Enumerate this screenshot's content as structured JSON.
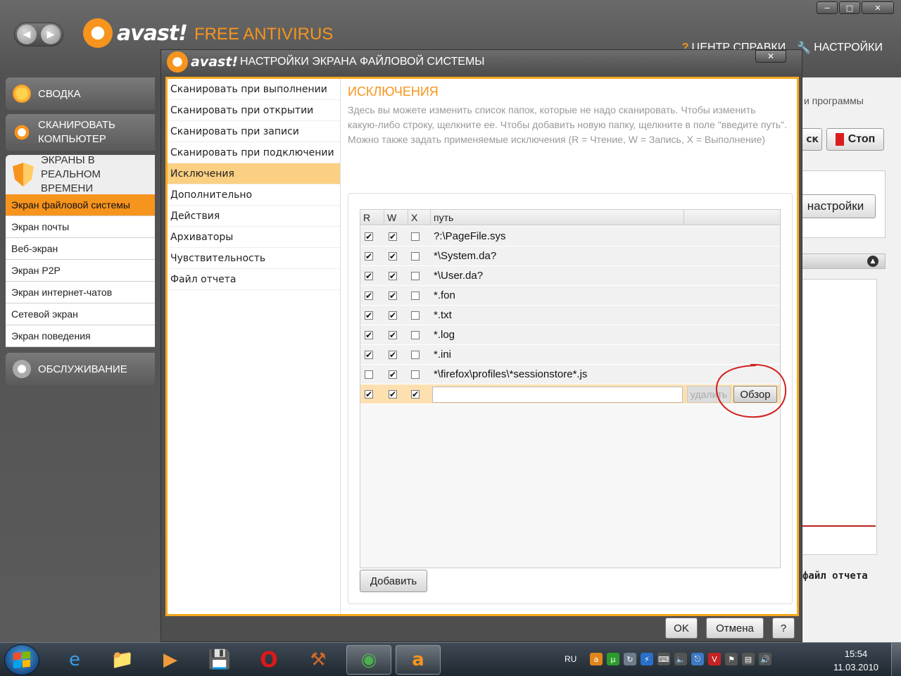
{
  "window_controls": {
    "minimize": "−",
    "maximize": "□",
    "close": "✕"
  },
  "brand": {
    "name": "avast!",
    "product": "FREE ANTIVIRUS",
    "accent": "#f7941d"
  },
  "top_links": {
    "help": "ЦЕНТР СПРАВКИ",
    "settings": "НАСТРОЙКИ"
  },
  "sidebar": {
    "summary": "СВОДКА",
    "scan": [
      "СКАНИРОВАТЬ",
      "КОМПЬЮТЕР"
    ],
    "realtime": [
      "ЭКРАНЫ В",
      "РЕАЛЬНОМ",
      "ВРЕМЕНИ"
    ],
    "shields": [
      {
        "label": "Экран файловой системы",
        "active": true
      },
      {
        "label": "Экран почты"
      },
      {
        "label": "Веб-экран"
      },
      {
        "label": "Экран P2P"
      },
      {
        "label": "Экран интернет-чатов"
      },
      {
        "label": "Сетевой экран"
      },
      {
        "label": "Экран поведения"
      }
    ],
    "maintenance": "ОБСЛУЖИВАНИЕ"
  },
  "behind": {
    "text_fragment": "ы и программы",
    "button_fragment": "ск",
    "stop": "Стоп",
    "settings_button": "настройки",
    "report_fragment": "файл отчета"
  },
  "dialog": {
    "brand": "avast!",
    "title": "НАСТРОЙКИ ЭКРАНА ФАЙЛОВОЙ СИСТЕМЫ",
    "close": "✕",
    "nav": [
      "Сканировать при выполнении",
      "Сканировать при открытии",
      "Сканировать при записи",
      "Сканировать при подключении",
      "Исключения",
      "Дополнительно",
      "Действия",
      "Архиваторы",
      "Чувствительность",
      "Файл отчета"
    ],
    "active_nav": "Исключения",
    "section_title": "ИСКЛЮЧЕНИЯ",
    "desc_line1": "Здесь вы можете изменить список папок, которые не надо сканировать. Чтобы изменить какую-либо строку, щелкните ее. Чтобы добавить новую папку, щелкните в поле \"введите путь\".",
    "desc_line2": "Можно также задать применяемые исключения (R = Чтение, W = Запись, X = Выполнение)",
    "table": {
      "headers": {
        "r": "R",
        "w": "W",
        "x": "X",
        "path": "путь"
      },
      "rows": [
        {
          "r": true,
          "w": true,
          "x": false,
          "path": "?:\\PageFile.sys"
        },
        {
          "r": true,
          "w": true,
          "x": false,
          "path": "*\\System.da?"
        },
        {
          "r": true,
          "w": true,
          "x": false,
          "path": "*\\User.da?"
        },
        {
          "r": true,
          "w": true,
          "x": false,
          "path": "*.fon"
        },
        {
          "r": true,
          "w": true,
          "x": false,
          "path": "*.txt"
        },
        {
          "r": true,
          "w": true,
          "x": false,
          "path": "*.log"
        },
        {
          "r": true,
          "w": true,
          "x": false,
          "path": "*.ini"
        },
        {
          "r": false,
          "w": true,
          "x": false,
          "path": "*\\firefox\\profiles\\*sessionstore*.js"
        }
      ],
      "edit_row": {
        "r": true,
        "w": true,
        "x": true,
        "path_value": "",
        "delete": "удалить",
        "browse": "Обзор"
      }
    },
    "add_button": "Добавить",
    "ok": "OK",
    "cancel": "Отмена",
    "help": "?"
  },
  "taskbar": {
    "lang": "RU",
    "time": "15:54",
    "date": "11.03.2010"
  }
}
